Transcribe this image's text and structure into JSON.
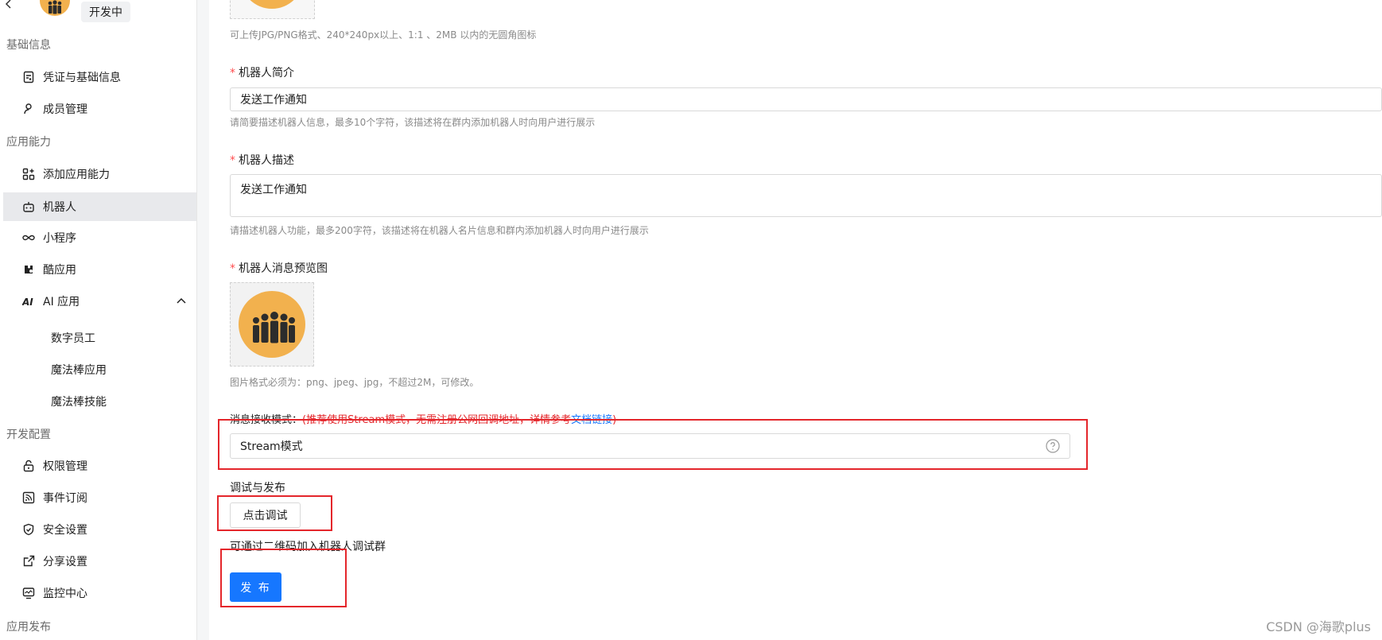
{
  "sidebar": {
    "status_badge": "开发中",
    "groups": [
      {
        "title": "基础信息"
      },
      {
        "title": "应用能力"
      },
      {
        "title": "开发配置"
      },
      {
        "title": "应用发布"
      }
    ],
    "items": {
      "credentials": "凭证与基础信息",
      "members": "成员管理",
      "add_capability": "添加应用能力",
      "robot": "机器人",
      "mini_program": "小程序",
      "cool_app": "酷应用",
      "ai_app": "AI 应用",
      "digital_employee": "数字员工",
      "magic_wand_app": "魔法棒应用",
      "magic_wand_skill": "魔法棒技能",
      "permissions": "权限管理",
      "event_subscription": "事件订阅",
      "security": "安全设置",
      "share": "分享设置",
      "monitor": "监控中心"
    }
  },
  "form": {
    "icon_hint": "可上传JPG/PNG格式、240*240px以上、1:1 、2MB 以内的无圆角图标",
    "intro_label": "机器人简介",
    "intro_value": "发送工作通知",
    "intro_hint": "请简要描述机器人信息，最多10个字符，该描述将在群内添加机器人时向用户进行展示",
    "desc_label": "机器人描述",
    "desc_value": "发送工作通知",
    "desc_hint": "请描述机器人功能，最多200字符，该描述将在机器人名片信息和群内添加机器人时向用户进行展示",
    "preview_label": "机器人消息预览图",
    "preview_hint": "图片格式必须为：png、jpeg、jpg，不超过2M，可修改。",
    "mode_label": "消息接收模式：",
    "mode_notice": "(推荐使用Stream模式，无需注册公网回调地址，详情参考",
    "mode_link": "文档链接",
    "mode_notice_end": ")",
    "mode_value": "Stream模式",
    "debug_label": "调试与发布",
    "debug_button": "点击调试",
    "qr_hint": "可通过二维码加入机器人调试群",
    "publish_button": "发 布"
  },
  "watermark": "CSDN @海歌plus",
  "colors": {
    "primary": "#1677ff",
    "required": "#ff4d4f",
    "highlight_box": "#e4262b",
    "avatar": "#f2b14e"
  },
  "icons": {
    "back": "chevron-left-icon",
    "credentials": "document-icon",
    "members": "user-icon",
    "add_capability": "grid-plus-icon",
    "robot": "robot-icon",
    "mini_program": "infinity-icon",
    "cool_app": "puzzle-icon",
    "ai_app": "ai-icon",
    "permissions": "lock-icon",
    "event_subscription": "feed-icon",
    "security": "shield-icon",
    "share": "share-icon",
    "monitor": "monitor-icon",
    "help": "question-circle-icon",
    "expand": "chevron-up-icon"
  }
}
